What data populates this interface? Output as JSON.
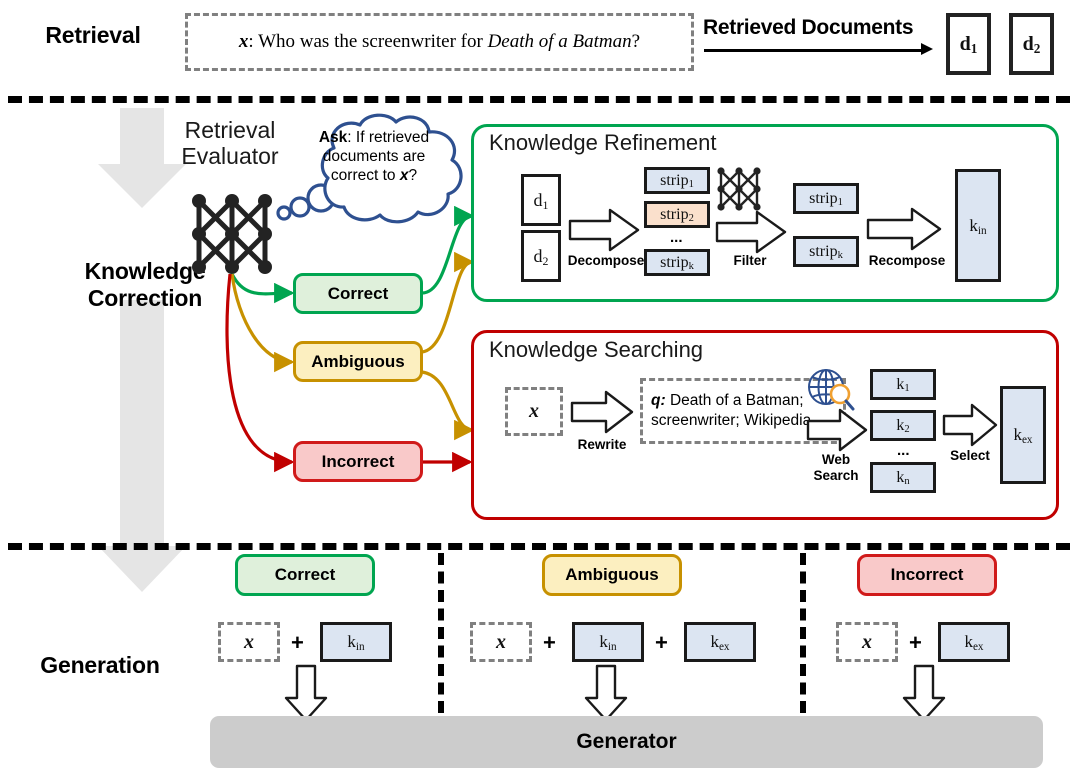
{
  "stages": [
    {
      "id": "retrieval",
      "label": "Retrieval"
    },
    {
      "id": "knowledge-correction",
      "label": "Knowledge\nCorrection",
      "line1": "Knowledge",
      "line2": "Correction"
    },
    {
      "id": "generation",
      "label": "Generation"
    }
  ],
  "retrieval": {
    "query_prefix": "x",
    "query_body": ": Who was the screenwriter for ",
    "query_title": "Death of a Batman",
    "query_suffix": "?",
    "arrow_label": "Retrieved Documents",
    "documents": [
      {
        "name": "d",
        "sub": "1"
      },
      {
        "name": "d",
        "sub": "2"
      }
    ]
  },
  "evaluator": {
    "title_line1": "Retrieval",
    "title_line2": "Evaluator",
    "icon": "neural-network-icon",
    "bubble": {
      "lead": "Ask",
      "text_1": ": If retrieved",
      "text_2": "documents are",
      "text_3": "correct to ",
      "x": "x",
      "text_4": "?"
    }
  },
  "labels": {
    "correct": "Correct",
    "ambiguous": "Ambiguous",
    "incorrect": "Incorrect"
  },
  "refinement": {
    "title": "Knowledge Refinement",
    "docs": [
      {
        "name": "d",
        "sub": "1"
      },
      {
        "name": "d",
        "sub": "2"
      }
    ],
    "step_decompose": "Decompose",
    "strips_in": [
      {
        "name": "strip",
        "sub": "1"
      },
      {
        "name": "strip",
        "sub": "2"
      },
      {
        "name": "strip",
        "sub": "k"
      }
    ],
    "ellipsis": "...",
    "filter_icon": "neural-network-icon",
    "step_filter": "Filter",
    "strips_out": [
      {
        "name": "strip",
        "sub": "1"
      },
      {
        "name": "strip",
        "sub": "k"
      }
    ],
    "step_recompose": "Recompose",
    "output": {
      "name": "k",
      "sub": "in"
    }
  },
  "searching": {
    "title": "Knowledge Searching",
    "input": "x",
    "step_rewrite": "Rewrite",
    "query_label": "q:",
    "query_line1": " Death of a Batman;",
    "query_line2": "screenwriter; Wikipedia",
    "web_icon": "globe-search-icon",
    "step_websearch_1": "Web",
    "step_websearch_2": "Search",
    "results": [
      {
        "name": "k",
        "sub": "1"
      },
      {
        "name": "k",
        "sub": "2"
      },
      {
        "name": "k",
        "sub": "n"
      }
    ],
    "ellipsis": "...",
    "step_select": "Select",
    "output": {
      "name": "k",
      "sub": "ex"
    }
  },
  "generation": {
    "columns": [
      {
        "badge": "Correct",
        "badge_kind": "correct",
        "items": [
          {
            "type": "query",
            "text": "x"
          },
          {
            "type": "plus",
            "text": "+"
          },
          {
            "type": "knowledge",
            "name": "k",
            "sub": "in"
          }
        ]
      },
      {
        "badge": "Ambiguous",
        "badge_kind": "ambiguous",
        "items": [
          {
            "type": "query",
            "text": "x"
          },
          {
            "type": "plus",
            "text": "+"
          },
          {
            "type": "knowledge",
            "name": "k",
            "sub": "in"
          },
          {
            "type": "plus",
            "text": "+"
          },
          {
            "type": "knowledge",
            "name": "k",
            "sub": "ex"
          }
        ]
      },
      {
        "badge": "Incorrect",
        "badge_kind": "incorrect",
        "items": [
          {
            "type": "query",
            "text": "x"
          },
          {
            "type": "plus",
            "text": "+"
          },
          {
            "type": "knowledge",
            "name": "k",
            "sub": "ex"
          }
        ]
      }
    ],
    "generator_label": "Generator"
  },
  "colors": {
    "correct": "#00A550",
    "ambiguous": "#C79100",
    "incorrect": "#C00000",
    "panel_green": "#00A550",
    "panel_red": "#C00000",
    "box_blue": "#DCE5F2",
    "box_peach": "#FAE0CC",
    "stage_arrow": "#E3E3E3",
    "generator": "#CCCCCC",
    "bubble_outline": "#2E5090",
    "globe": "#2E5090",
    "magnifier": "#F0A030"
  }
}
